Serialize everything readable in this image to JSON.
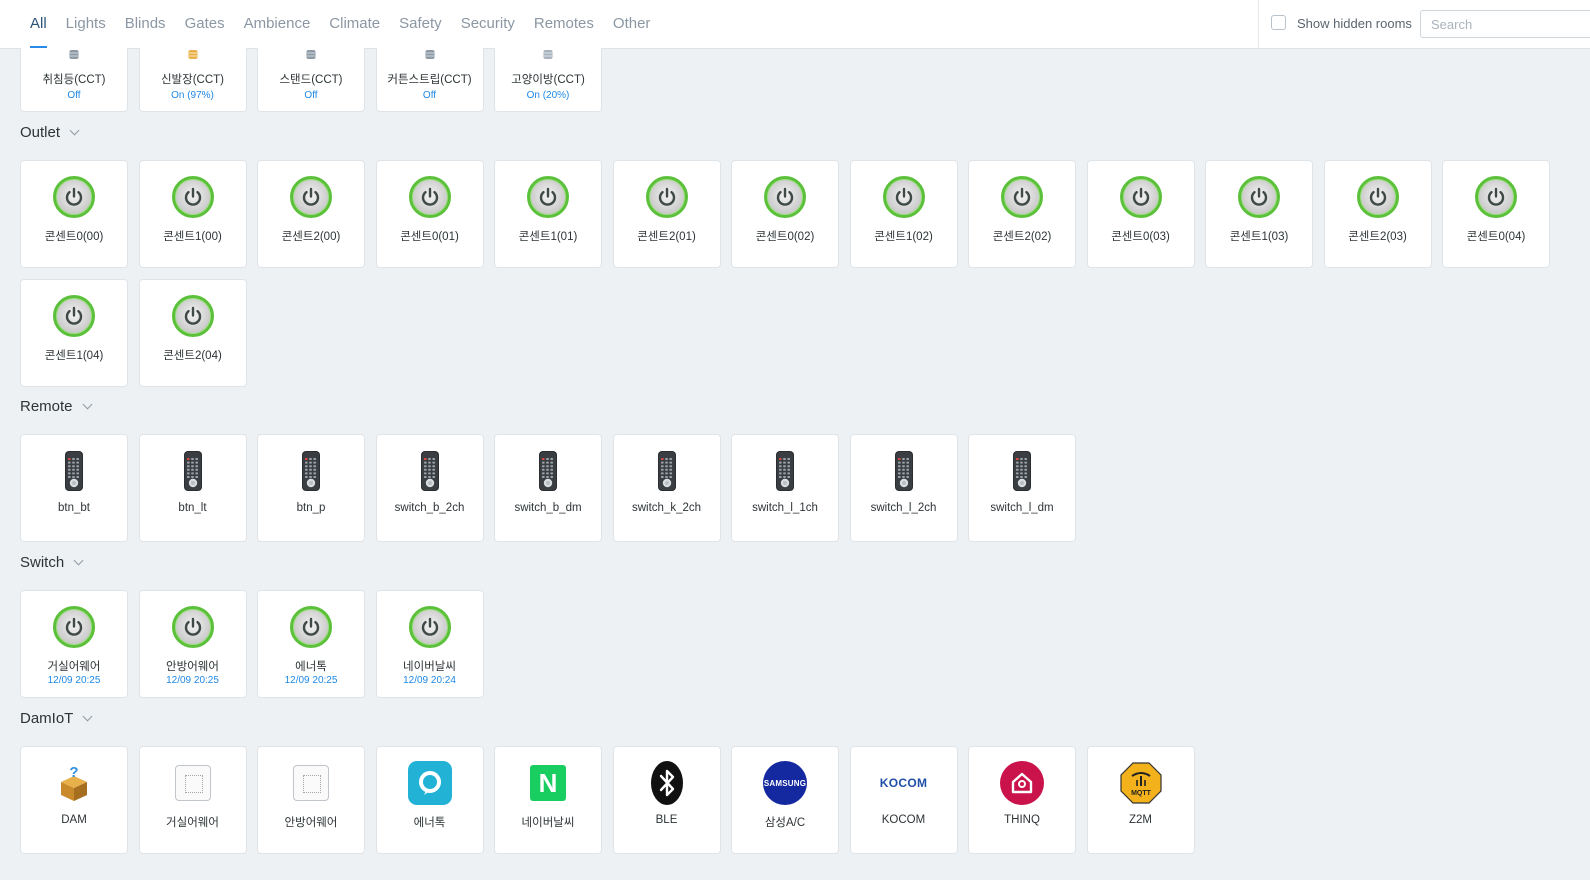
{
  "tabs": [
    "All",
    "Lights",
    "Blinds",
    "Gates",
    "Ambience",
    "Climate",
    "Safety",
    "Security",
    "Remotes",
    "Other"
  ],
  "show_hidden_label": "Show hidden rooms",
  "search_placeholder": "Search",
  "lights": [
    {
      "label": "취침등(CCT)",
      "status": "Off"
    },
    {
      "label": "신발장(CCT)",
      "status": "On (97%)"
    },
    {
      "label": "스탠드(CCT)",
      "status": "Off"
    },
    {
      "label": "커튼스트립(CCT)",
      "status": "Off"
    },
    {
      "label": "고양이방(CCT)",
      "status": "On (20%)"
    }
  ],
  "sections": {
    "outlet": {
      "title": "Outlet",
      "items": [
        "콘센트0(00)",
        "콘센트1(00)",
        "콘센트2(00)",
        "콘센트0(01)",
        "콘센트1(01)",
        "콘센트2(01)",
        "콘센트0(02)",
        "콘센트1(02)",
        "콘센트2(02)",
        "콘센트0(03)",
        "콘센트1(03)",
        "콘센트2(03)",
        "콘센트0(04)",
        "콘센트1(04)",
        "콘센트2(04)"
      ]
    },
    "remote": {
      "title": "Remote",
      "items": [
        "btn_bt",
        "btn_lt",
        "btn_p",
        "switch_b_2ch",
        "switch_b_dm",
        "switch_k_2ch",
        "switch_l_1ch",
        "switch_l_2ch",
        "switch_l_dm"
      ]
    },
    "switch": {
      "title": "Switch",
      "items": [
        {
          "label": "거실어웨어",
          "status": "12/09 20:25"
        },
        {
          "label": "안방어웨어",
          "status": "12/09 20:25"
        },
        {
          "label": "에너톡",
          "status": "12/09 20:25"
        },
        {
          "label": "네이버날씨",
          "status": "12/09 20:24"
        }
      ]
    },
    "damiot": {
      "title": "DamIoT",
      "items": [
        {
          "label": "DAM",
          "icon": "box-icon"
        },
        {
          "label": "거실어웨어",
          "icon": "placeholder-icon"
        },
        {
          "label": "안방어웨어",
          "icon": "placeholder-icon"
        },
        {
          "label": "에너톡",
          "icon": "enertalk-icon"
        },
        {
          "label": "네이버날씨",
          "icon": "naver-icon"
        },
        {
          "label": "BLE",
          "icon": "bluetooth-icon"
        },
        {
          "label": "삼성A/C",
          "icon": "samsung-icon"
        },
        {
          "label": "KOCOM",
          "icon": "kocom-icon"
        },
        {
          "label": "THINQ",
          "icon": "thinq-icon"
        },
        {
          "label": "Z2M",
          "icon": "mqtt-icon"
        }
      ],
      "icon_text": {
        "samsung": "SAMSUNG",
        "kocom": "KOCOM",
        "naver": "N",
        "mqtt": "MQTT",
        "box": "?"
      }
    }
  },
  "colors": {
    "accent": "#2a8ae8",
    "status": "#1e88e5",
    "power_green": "#5cc13a"
  }
}
